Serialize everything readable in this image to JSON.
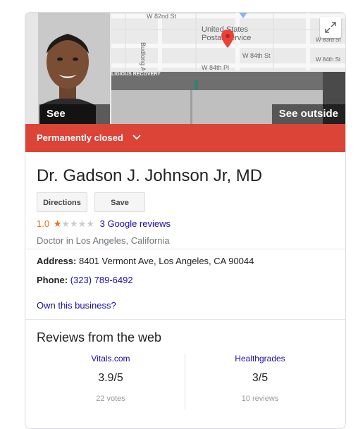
{
  "media": {
    "see_photos_label": "See photos",
    "see_outside_label": "See outside",
    "map_labels": {
      "street1": "W 82nd St",
      "poi": "United States Postal Service",
      "street2": "W 84th St",
      "street3": "W 84th Pl",
      "street4": "W 83rd St",
      "street5": "W 84th St",
      "avenue": "Budlong Ave"
    },
    "streetview_sign": "LIGIOUS RECOVERY"
  },
  "status": {
    "label": "Permanently closed"
  },
  "business": {
    "name": "Dr. Gadson J. Johnson Jr, MD",
    "category": "Doctor in Los Angeles, California"
  },
  "actions": {
    "directions_label": "Directions",
    "save_label": "Save"
  },
  "rating": {
    "value_text": "1.0",
    "stars": 1,
    "stars_max": 5,
    "reviews_link": "3 Google reviews"
  },
  "details": {
    "address_label": "Address:",
    "address_value": "8401 Vermont Ave, Los Angeles, CA 90044",
    "phone_label": "Phone:",
    "phone_value": "(323) 789-6492",
    "own_business_link": "Own this business?"
  },
  "reviews_web": {
    "title": "Reviews from the web",
    "sources": [
      {
        "name": "Vitals.com",
        "score": "3.9/5",
        "count": "22 votes"
      },
      {
        "name": "Healthgrades",
        "score": "3/5",
        "count": "10 reviews"
      }
    ]
  },
  "colors": {
    "closed_bar": "#db4437",
    "link": "#1a0dab",
    "star": "#e7711b",
    "map_pin": "#ea4335"
  }
}
